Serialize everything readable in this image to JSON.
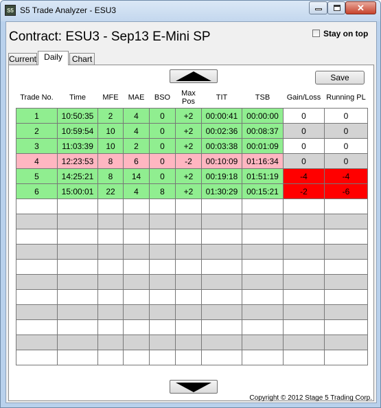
{
  "window": {
    "title": "S5 Trade Analyzer - ESU3",
    "icon_text": "S5"
  },
  "header": {
    "contract": "Contract: ESU3 - Sep13 E-Mini SP",
    "stay_on_top_label": "Stay on top"
  },
  "tabs": [
    {
      "label": "Current"
    },
    {
      "label": "Daily"
    },
    {
      "label": "Chart"
    }
  ],
  "toolbar": {
    "save_label": "Save"
  },
  "table": {
    "columns": [
      "Trade No.",
      "Time",
      "MFE",
      "MAE",
      "BSO",
      "Max\nPos",
      "TIT",
      "TSB",
      "Gain/Loss",
      "Running PL"
    ],
    "rows": [
      {
        "trade_no": "1",
        "time": "10:50:35",
        "mfe": "2",
        "mae": "4",
        "bso": "0",
        "max_pos": "+2",
        "tit": "00:00:41",
        "tsb": "00:00:00",
        "gain_loss": "0",
        "running_pl": "0",
        "status": "win"
      },
      {
        "trade_no": "2",
        "time": "10:59:54",
        "mfe": "10",
        "mae": "4",
        "bso": "0",
        "max_pos": "+2",
        "tit": "00:02:36",
        "tsb": "00:08:37",
        "gain_loss": "0",
        "running_pl": "0",
        "status": "win"
      },
      {
        "trade_no": "3",
        "time": "11:03:39",
        "mfe": "10",
        "mae": "2",
        "bso": "0",
        "max_pos": "+2",
        "tit": "00:03:38",
        "tsb": "00:01:09",
        "gain_loss": "0",
        "running_pl": "0",
        "status": "win"
      },
      {
        "trade_no": "4",
        "time": "12:23:53",
        "mfe": "8",
        "mae": "6",
        "bso": "0",
        "max_pos": "-2",
        "tit": "00:10:09",
        "tsb": "01:16:34",
        "gain_loss": "0",
        "running_pl": "0",
        "status": "loss"
      },
      {
        "trade_no": "5",
        "time": "14:25:21",
        "mfe": "8",
        "mae": "14",
        "bso": "0",
        "max_pos": "+2",
        "tit": "00:19:18",
        "tsb": "01:51:19",
        "gain_loss": "-4",
        "running_pl": "-4",
        "status": "win"
      },
      {
        "trade_no": "6",
        "time": "15:00:01",
        "mfe": "22",
        "mae": "4",
        "bso": "8",
        "max_pos": "+2",
        "tit": "01:30:29",
        "tsb": "00:15:21",
        "gain_loss": "-2",
        "running_pl": "-6",
        "status": "win"
      }
    ],
    "empty_rows": 11
  },
  "footer": {
    "copyright": "Copyright © 2012 Stage 5 Trading Corp."
  },
  "colors": {
    "win": "#90ee90",
    "loss": "#ffb6c1",
    "negative": "#ff0000",
    "alt_row": "#d3d3d3"
  }
}
